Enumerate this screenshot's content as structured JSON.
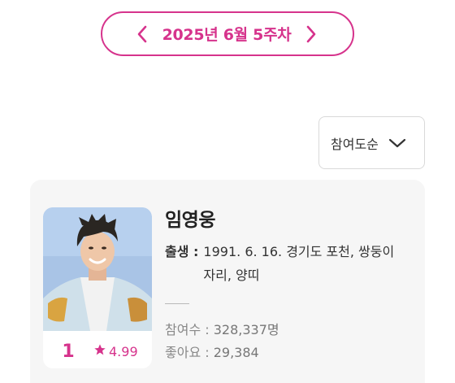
{
  "week_selector": {
    "label": "2025년 6월 5주차",
    "prev_icon": "chevron-left-icon",
    "next_icon": "chevron-right-icon"
  },
  "sort": {
    "selected": "참여도순",
    "icon": "chevron-down-icon"
  },
  "ranking": [
    {
      "rank": "1",
      "rating": "4.99",
      "rating_icon": "star-icon",
      "name": "임영웅",
      "birth_label": "출생 :",
      "birth_value": "1991. 6. 16. 경기도 포천, 쌍둥이자리, 양띠",
      "participants_label": "참여수 :",
      "participants_value": "328,337명",
      "likes_label": "좋아요 :",
      "likes_value": "29,384"
    }
  ],
  "colors": {
    "accent": "#d6338c",
    "card_bg": "#f6f6f6",
    "photo_bg": "#a9c4e6"
  }
}
